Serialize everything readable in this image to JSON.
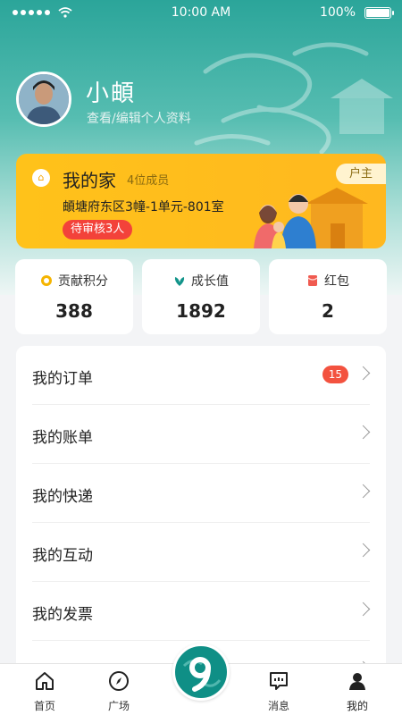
{
  "status_bar": {
    "time": "10:00 AM",
    "battery": "100%"
  },
  "profile": {
    "name": "小頔",
    "edit_link": "查看/编辑个人资料"
  },
  "family": {
    "title": "我的家",
    "member_count": "4位成员",
    "address": "頔塘府东区3幢-1单元-801室",
    "pending": "待审核3人",
    "role": "户主",
    "icon": "home-badge-icon"
  },
  "stats": [
    {
      "label": "贡献积分",
      "value": "388",
      "icon": "coin-icon",
      "color": "#f5b400"
    },
    {
      "label": "成长值",
      "value": "1892",
      "icon": "sprout-icon",
      "color": "#12948a"
    },
    {
      "label": "红包",
      "value": "2",
      "icon": "red-envelope-icon",
      "color": "#f05a50"
    }
  ],
  "menu": [
    {
      "label": "我的订单",
      "badge": "15"
    },
    {
      "label": "我的账单"
    },
    {
      "label": "我的快递"
    },
    {
      "label": "我的互动"
    },
    {
      "label": "我的发票"
    },
    {
      "label": ""
    }
  ],
  "tabbar": [
    {
      "label": "首页",
      "icon": "home-icon"
    },
    {
      "label": "广场",
      "icon": "compass-icon"
    },
    {
      "label": "",
      "icon": "center-logo-icon"
    },
    {
      "label": "消息",
      "icon": "message-icon"
    },
    {
      "label": "我的",
      "icon": "person-icon"
    }
  ],
  "colors": {
    "primary": "#12948a",
    "family_card": "#ffbd1c",
    "badge": "#f3523f"
  }
}
